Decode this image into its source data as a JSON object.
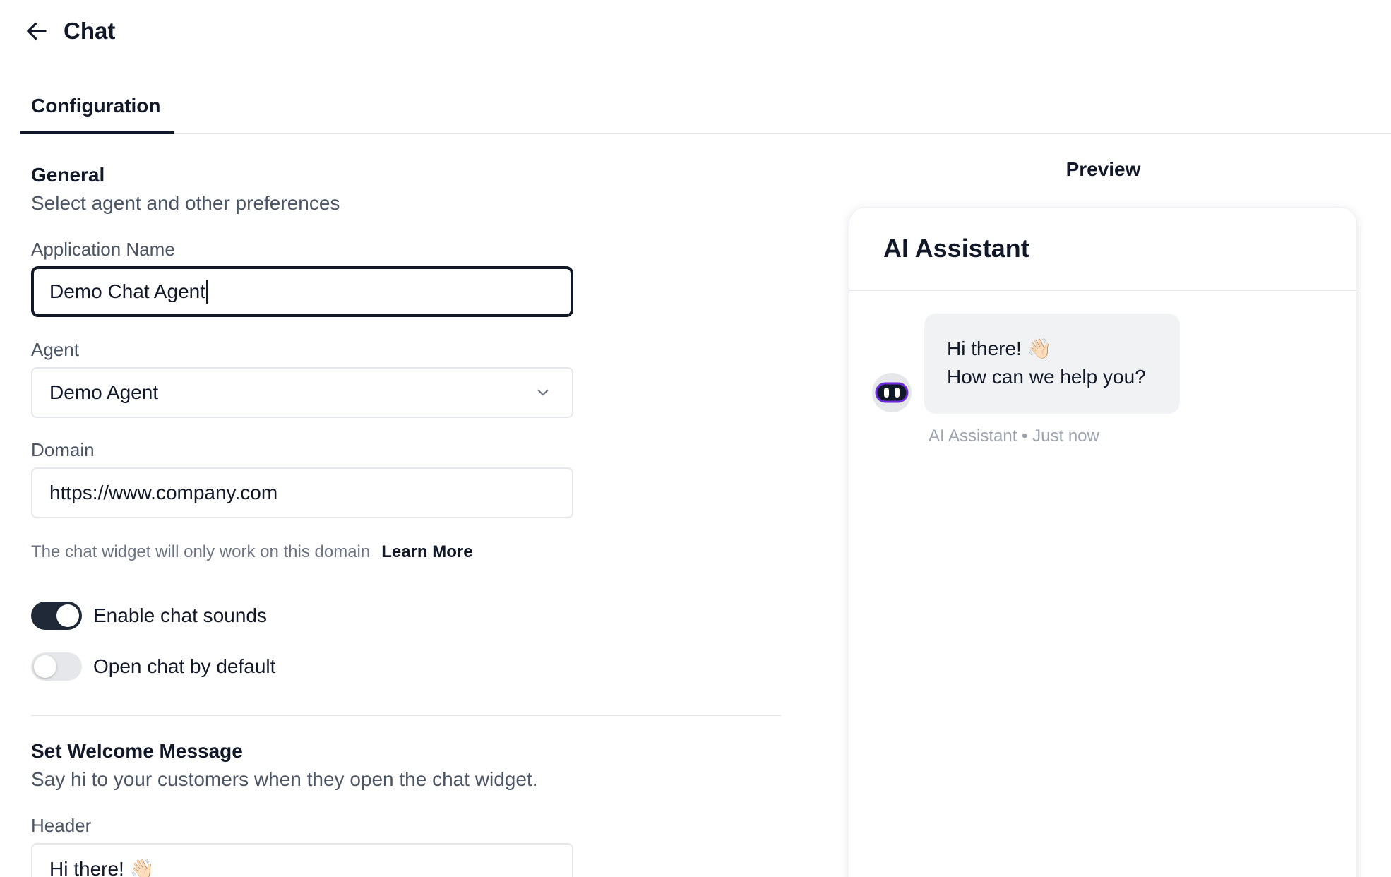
{
  "header": {
    "title": "Chat"
  },
  "tabs": [
    {
      "label": "Configuration"
    }
  ],
  "general": {
    "title": "General",
    "subtitle": "Select agent and other preferences",
    "application_name": {
      "label": "Application Name",
      "value": "Demo Chat Agent"
    },
    "agent": {
      "label": "Agent",
      "value": "Demo Agent"
    },
    "domain": {
      "label": "Domain",
      "value": "https://www.company.com",
      "hint": "The chat widget will only work on this domain",
      "learn_more": "Learn More"
    },
    "toggles": [
      {
        "label": "Enable chat sounds",
        "on": true
      },
      {
        "label": "Open chat by default",
        "on": false
      }
    ]
  },
  "welcome": {
    "title": "Set Welcome Message",
    "subtitle": "Say hi to your customers when they open the chat widget.",
    "header_label": "Header",
    "header_value": "Hi there! 👋🏻"
  },
  "preview": {
    "title": "Preview",
    "assistant_name": "AI Assistant",
    "message_line1": "Hi there! 👋🏻",
    "message_line2": "How can we help you?",
    "meta": "AI Assistant • Just now"
  },
  "colors": {
    "accent": "#1f2937",
    "border": "#e5e7eb",
    "bubble": "#f1f2f4"
  }
}
